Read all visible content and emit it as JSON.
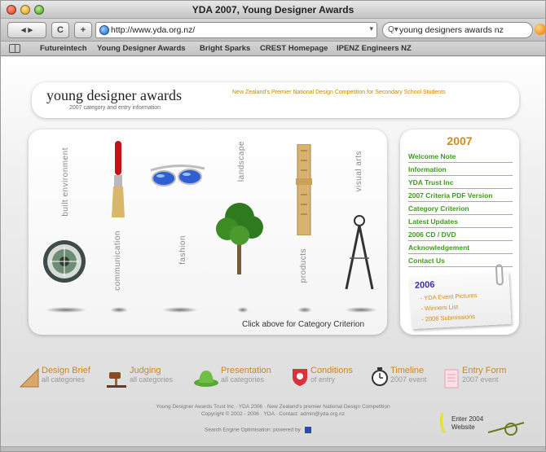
{
  "window": {
    "title": "YDA 2007, Young Designer Awards"
  },
  "toolbar": {
    "back_label": "◂ ▸",
    "reload_label": "C",
    "add_label": "+",
    "url": "http://www.yda.org.nz/",
    "search_value": "young designers awards nz"
  },
  "bookmarks": [
    "Futureintech",
    "Young Designer Awards",
    "Bright Sparks",
    "CREST Homepage",
    "IPENZ Engineers NZ"
  ],
  "header": {
    "title": "young designer awards",
    "subtitle": "2007 category and entry information",
    "tagline": "New Zealand's Premier National Design Competition for Secondary School Students"
  },
  "categories": {
    "built_environment": "built environment",
    "communication": "communication",
    "fashion": "fashion",
    "landscape": "landscape",
    "products": "products",
    "visual_arts": "visual arts",
    "click_note": "Click above for Category Criterion"
  },
  "side": {
    "year": "2007",
    "nav": [
      "Welcome Note",
      "Information",
      "YDA Trust Inc",
      "2007 Criteria PDF Version",
      "Category Criterion",
      "Latest Updates",
      "2006 CD / DVD",
      "Acknowledgement",
      "Contact Us"
    ],
    "archive": {
      "year": "2006",
      "items": [
        "- YDA Event Pictures",
        "- Winners List",
        "- 2006 Submissions"
      ]
    }
  },
  "bottom_nav": [
    {
      "title": "Design Brief",
      "sub": "all categories",
      "icon": "ruler-icon"
    },
    {
      "title": "Judging",
      "sub": "all categories",
      "icon": "gavel-icon"
    },
    {
      "title": "Presentation",
      "sub": "all categories",
      "icon": "hat-icon"
    },
    {
      "title": "Conditions",
      "sub": "of entry",
      "icon": "badge-icon"
    },
    {
      "title": "Timeline",
      "sub": "2007 event",
      "icon": "clock-icon"
    },
    {
      "title": "Entry Form",
      "sub": "2007 event",
      "icon": "form-icon"
    }
  ],
  "footer": {
    "line1": "Young Designer Awards Trust Inc · YDA 2006 · New Zealand's premier National Design Competition",
    "line2": "Copyright © 2002 - 2006 · YDA · Contact: admin@yda.org.nz",
    "seo": "Search Engine Optimisation: powered by",
    "enter_2004": "Enter 2004 Website"
  },
  "colors": {
    "accent_green": "#3f9a1c",
    "accent_orange": "#d28a1a",
    "archive_blue": "#3a2fa0"
  }
}
